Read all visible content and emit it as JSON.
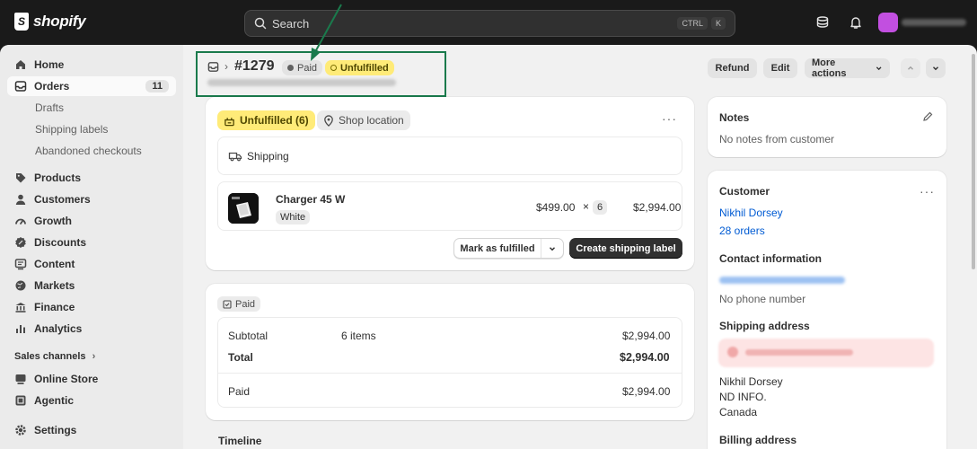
{
  "topbar": {
    "logo_text": "shopify",
    "search_placeholder": "Search",
    "shortcut_keys": [
      "CTRL",
      "K"
    ],
    "icons": [
      "store-icon",
      "bell-icon"
    ]
  },
  "sidebar": {
    "items": [
      {
        "label": "Home"
      },
      {
        "label": "Orders",
        "count": "11"
      },
      {
        "label": "Drafts"
      },
      {
        "label": "Shipping labels"
      },
      {
        "label": "Abandoned checkouts"
      },
      {
        "label": "Products"
      },
      {
        "label": "Customers"
      },
      {
        "label": "Growth"
      },
      {
        "label": "Discounts"
      },
      {
        "label": "Content"
      },
      {
        "label": "Markets"
      },
      {
        "label": "Finance"
      },
      {
        "label": "Analytics"
      }
    ],
    "sales_channels_label": "Sales channels",
    "channels": [
      {
        "label": "Online Store"
      },
      {
        "label": "Agentic"
      }
    ],
    "settings_label": "Settings"
  },
  "header": {
    "order_number": "#1279",
    "payment_status": "Paid",
    "fulfillment_status": "Unfulfilled",
    "buttons": {
      "refund": "Refund",
      "edit": "Edit",
      "more_actions": "More actions"
    }
  },
  "fulfillment_card": {
    "status_tag": "Unfulfilled (6)",
    "location_tag": "Shop location",
    "shipping_label": "Shipping",
    "line_item": {
      "name": "Charger 45 W",
      "variant": "White",
      "unit_price": "$499.00",
      "times": "×",
      "quantity": "6",
      "total": "$2,994.00"
    },
    "mark_fulfilled_label": "Mark as fulfilled",
    "create_label_button": "Create shipping label"
  },
  "payment_card": {
    "status_tag": "Paid",
    "rows": {
      "subtotal_label": "Subtotal",
      "subtotal_items": "6 items",
      "subtotal_value": "$2,994.00",
      "total_label": "Total",
      "total_value": "$2,994.00",
      "paid_label": "Paid",
      "paid_value": "$2,994.00"
    }
  },
  "timeline": {
    "title": "Timeline"
  },
  "notes": {
    "title": "Notes",
    "text": "No notes from customer"
  },
  "customer": {
    "title": "Customer",
    "name": "Nikhil Dorsey",
    "orders": "28 orders",
    "contact_title": "Contact information",
    "phone": "No phone number",
    "shipping_title": "Shipping address",
    "address_lines": [
      "Nikhil Dorsey",
      "ND INFO.",
      "Canada"
    ],
    "billing_title": "Billing address"
  },
  "colors": {
    "topbar_bg": "#1a1a1a",
    "unfulfilled_yellow": "#ffeb78",
    "link_blue": "#005bd3",
    "annotation_green": "#1a7a4c"
  }
}
